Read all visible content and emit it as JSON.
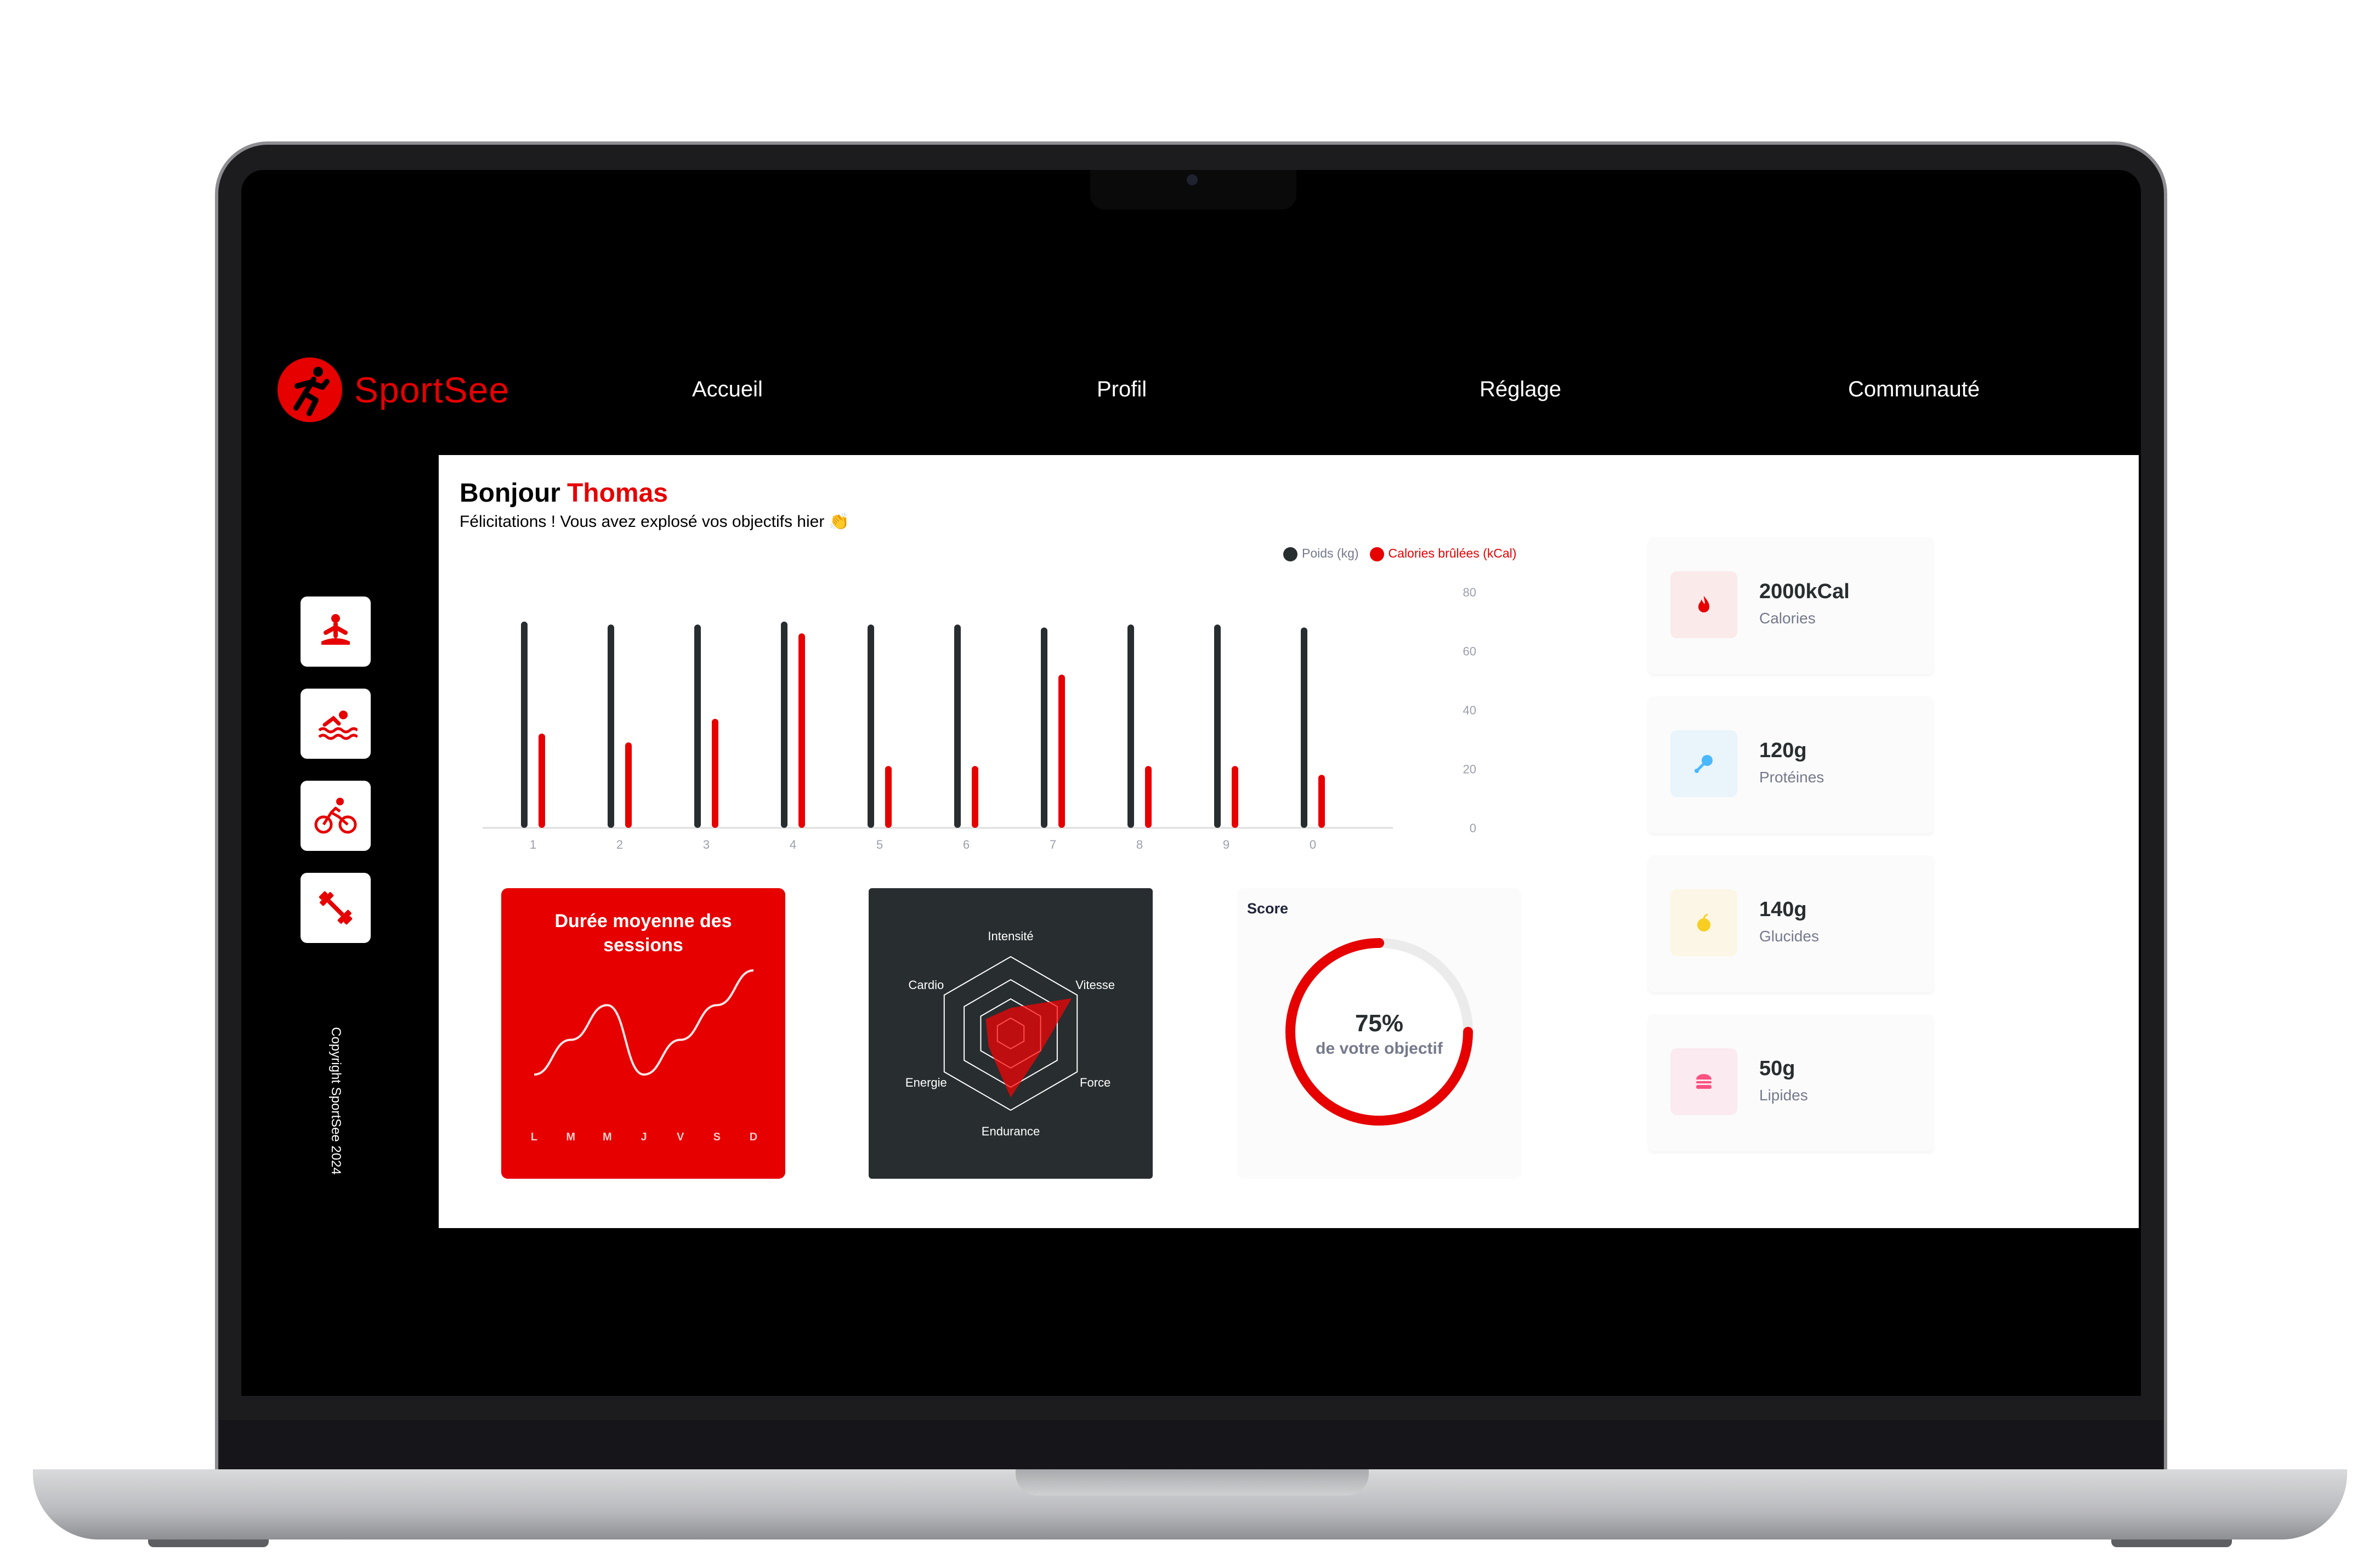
{
  "app": {
    "name": "SportSee"
  },
  "nav": {
    "items": [
      "Accueil",
      "Profil",
      "Réglage",
      "Communauté"
    ]
  },
  "sidebar": {
    "icons": [
      "meditation-icon",
      "swimming-icon",
      "cycling-icon",
      "weightlifting-icon"
    ],
    "copyright": "Copyright SportSee 2024"
  },
  "greeting": {
    "prefix": "Bonjour",
    "name": "Thomas",
    "message": "Félicitations ! Vous avez explosé vos objectifs hier 👏"
  },
  "colors": {
    "accent": "#e60000",
    "dark": "#282d30"
  },
  "charts": [
    {
      "type": "bar",
      "categories": [
        "1",
        "2",
        "3",
        "4",
        "5",
        "6",
        "7",
        "8",
        "9",
        "0"
      ],
      "series": [
        {
          "name": "Poids (kg)",
          "color": "#282d30",
          "values": [
            70,
            69,
            69,
            70,
            69,
            69,
            68,
            69,
            69,
            68
          ]
        },
        {
          "name": "Calories brûlées (kCal)",
          "color": "#e60000",
          "values": [
            32,
            29,
            37,
            66,
            21,
            21,
            52,
            21,
            21,
            18
          ]
        }
      ],
      "ylim": [
        0,
        80
      ],
      "yticks": [
        0,
        20,
        40,
        60,
        80
      ],
      "legend": "top-right"
    },
    {
      "type": "line",
      "title": "Durée moyenne des sessions",
      "categories": [
        "L",
        "M",
        "M",
        "J",
        "V",
        "S",
        "D"
      ],
      "values": [
        30,
        40,
        50,
        30,
        40,
        50,
        60
      ]
    },
    {
      "type": "radar",
      "axes": [
        "Intensité",
        "Vitesse",
        "Force",
        "Endurance",
        "Energie",
        "Cardio"
      ],
      "values": [
        80,
        220,
        110,
        200,
        80,
        90
      ],
      "max": 240
    },
    {
      "type": "pie",
      "title": "Score",
      "value": 0.75,
      "label": "75%",
      "sublabel": "de votre objectif"
    }
  ],
  "kpis": [
    {
      "value": "2000kCal",
      "label": "Calories",
      "icon": "flame-icon",
      "bg": "#fbeaea",
      "color": "#e60000"
    },
    {
      "value": "120g",
      "label": "Protéines",
      "icon": "chicken-icon",
      "bg": "#e9f4fb",
      "color": "#4ab8ff"
    },
    {
      "value": "140g",
      "label": "Glucides",
      "icon": "apple-icon",
      "bg": "#fbf6e5",
      "color": "#f9ce23"
    },
    {
      "value": "50g",
      "label": "Lipides",
      "icon": "burger-icon",
      "bg": "#fbeaef",
      "color": "#fd5181"
    }
  ]
}
